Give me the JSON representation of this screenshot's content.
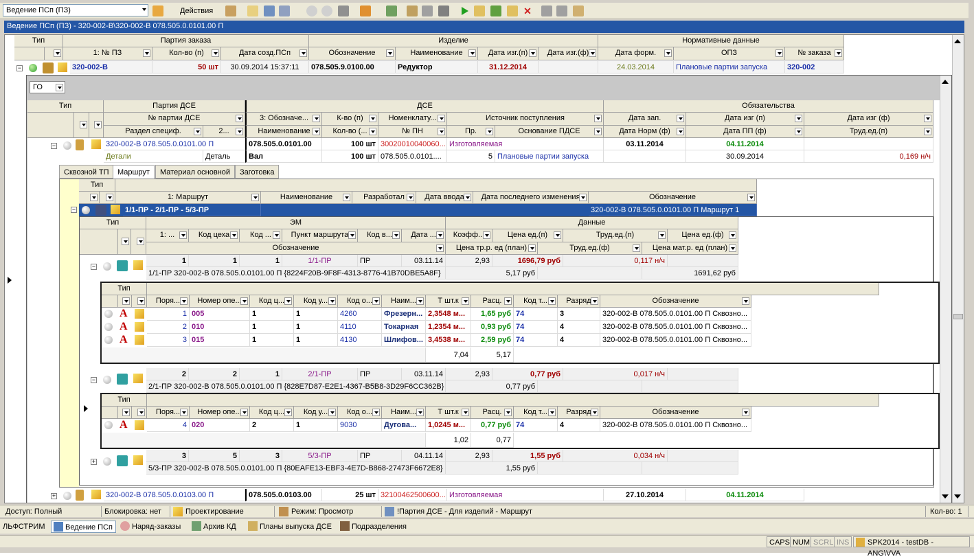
{
  "toolbar": {
    "combo_value": "Ведение ПСп (ПЗ)",
    "actions_label": "Действия"
  },
  "title": "Ведение ПСп (ПЗ) - 320-002-В\\320-002-В 078.505.0.0101.00 П",
  "top_grid": {
    "group_headers": [
      "Тип",
      "Партия заказа",
      "Изделие",
      "Нормативные данные"
    ],
    "columns": [
      "1: № ПЗ",
      "Кол-во (п)",
      "Дата созд.ПСп",
      "Обозначение",
      "Наименование",
      "Дата изг.(п)",
      "Дата изг.(ф)",
      "Дата форм.",
      "ОПЗ",
      "№ заказа"
    ],
    "row": {
      "pz": "320-002-В",
      "qty": "50 шт",
      "created": "30.09.2014 15:37:11",
      "designation": "078.505.9.0100.00",
      "name": "Редуктор",
      "date_plan": "31.12.2014",
      "date_fact": "",
      "date_form": "24.03.2014",
      "opz": "Плановые партии запуска",
      "order_no": "320-002"
    }
  },
  "go_filter": "ГО",
  "dse_grid": {
    "group_headers": [
      "Тип",
      "Партия ДСЕ",
      "ДСЕ",
      "Обязательства"
    ],
    "row1_headers": [
      "№ партии ДСЕ",
      "3: Обозначе...",
      "К-во (п)",
      "Номенклату...",
      "Источник поступления",
      "Дата зап.",
      "Дата изг (п)",
      "Дата изг (ф)"
    ],
    "row2_headers": [
      "Раздел специф.",
      "2...",
      "Наименование",
      "Кол-во (...",
      "№ ПН",
      "Пр.",
      "Основание ПДСЕ",
      "Дата Норм (ф)",
      "Дата ПП (ф)",
      "Труд.ед.(п)"
    ],
    "item1": {
      "batch": "320-002-В 078.505.0.0101.00 П",
      "designation": "078.505.0.0101.00",
      "qty": "100 шт",
      "nomen": "30020010040060...",
      "source": "Изготовляемая",
      "date_start": "03.11.2014",
      "date_make": "04.11.2014",
      "section": "Детали",
      "type": "Деталь",
      "name": "Вал",
      "qty2": "100 шт",
      "pn": "078.505.0.0101....",
      "pr": "5",
      "basis": "Плановые партии запуска",
      "date_pp": "30.09.2014",
      "labor": "0,169 н/ч"
    },
    "item2": {
      "batch": "320-002-В 078.505.0.0103.00 П",
      "designation": "078.505.0.0103.00",
      "qty": "25 шт",
      "nomen": "32100462500600...",
      "source": "Изготовляемая",
      "date_start": "27.10.2014",
      "date_make": "04.11.2014"
    }
  },
  "tabs": [
    "Сквозной ТП",
    "Маршрут",
    "Материал основной",
    "Заготовка"
  ],
  "route_grid": {
    "headers": [
      "Тип",
      "1: Маршрут",
      "Наименование",
      "Разработал",
      "Дата ввода",
      "Дата последнего изменения",
      "Обозначение"
    ],
    "row": {
      "route": "1/1-ПР - 2/1-ПР - 5/3-ПР",
      "designation": "320-002-В 078.505.0.0101.00 П Маршрут 1"
    }
  },
  "em_grid": {
    "group_headers": [
      "Тип",
      "ЭМ",
      "Данные"
    ],
    "row1_headers": [
      "1: ...",
      "Код цеха",
      "Код ...",
      "Пункт маршрута",
      "Код в...",
      "Дата ...",
      "Коэфф...",
      "Цена ед.(п)",
      "Труд.ед.(п)",
      "Цена ед.(ф)"
    ],
    "row2_headers": [
      "Обозначение",
      "Цена тр.р. ед (план)",
      "Труд.ед.(ф)",
      "Цена мат.р. ед (план)"
    ],
    "rows": [
      {
        "n1": "1",
        "n2": "1",
        "n3": "1",
        "point": "1/1-ПР",
        "code": "ПР",
        "date": "03.11.14",
        "coef": "2,93",
        "price": "1696,79 руб",
        "labor": "0,117 н/ч",
        "desc": "1/1-ПР 320-002-В 078.505.0.0101.00 П {8224F20B-9F8F-4313-8776-41B70DBE5A8F}",
        "price_tr": "5,17 руб",
        "price_mat": "1691,62 руб"
      },
      {
        "n1": "2",
        "n2": "2",
        "n3": "1",
        "point": "2/1-ПР",
        "code": "ПР",
        "date": "03.11.14",
        "coef": "2,93",
        "price": "0,77 руб",
        "labor": "0,017 н/ч",
        "desc": "2/1-ПР 320-002-В 078.505.0.0101.00 П {828E7D87-E2E1-4367-B5B8-3D29F6CC362B}",
        "price_tr": "0,77 руб",
        "price_mat": ""
      },
      {
        "n1": "3",
        "n2": "5",
        "n3": "3",
        "point": "5/3-ПР",
        "code": "ПР",
        "date": "04.11.14",
        "coef": "2,93",
        "price": "1,55 руб",
        "labor": "0,034 н/ч",
        "desc": "5/3-ПР 320-002-В 078.505.0.0101.00 П {80EAFE13-EBF3-4E7D-B868-27473F6672E8}",
        "price_tr": "1,55 руб",
        "price_mat": ""
      }
    ]
  },
  "ops_headers": [
    "Тип",
    "Поря...",
    "Номер опе...",
    "Код ц...",
    "Код у...",
    "Код о...",
    "Наим...",
    "Т шт.к",
    "Расц.",
    "Код т...",
    "Разряд",
    "Обозначение"
  ],
  "ops1": [
    {
      "order": "1",
      "num": "005",
      "c1": "1",
      "c2": "1",
      "code": "4260",
      "name": "Фрезерн...",
      "t": "2,3548 м...",
      "rate": "1,65 руб",
      "tc": "74",
      "grade": "3",
      "desig": "320-002-В 078.505.0.0101.00 П Сквозно..."
    },
    {
      "order": "2",
      "num": "010",
      "c1": "1",
      "c2": "1",
      "code": "4110",
      "name": "Токарная",
      "t": "1,2354 м...",
      "rate": "0,93 руб",
      "tc": "74",
      "grade": "4",
      "desig": "320-002-В 078.505.0.0101.00 П Сквозно..."
    },
    {
      "order": "3",
      "num": "015",
      "c1": "1",
      "c2": "1",
      "code": "4130",
      "name": "Шлифов...",
      "t": "3,4538 м...",
      "rate": "2,59 руб",
      "tc": "74",
      "grade": "4",
      "desig": "320-002-В 078.505.0.0101.00 П Сквозно..."
    }
  ],
  "ops1_totals": {
    "t": "7,04",
    "rate": "5,17"
  },
  "ops2": [
    {
      "order": "4",
      "num": "020",
      "c1": "2",
      "c2": "1",
      "code": "9030",
      "name": "Дугова...",
      "t": "1,0245 м...",
      "rate": "0,77 руб",
      "tc": "74",
      "grade": "4",
      "desig": "320-002-В 078.505.0.0101.00 П Сквозно..."
    }
  ],
  "ops2_totals": {
    "t": "1,02",
    "rate": "0,77"
  },
  "status": {
    "access": "Доступ: Полный",
    "lock": "Блокировка: нет",
    "mode1": "Проектирование",
    "mode2": "Режим: Просмотр",
    "context": "!Партия ДСЕ - Для изделий - Маршрут",
    "count": "Кол-во: 1"
  },
  "taskbar": [
    "ЛЬФСТРИМ",
    "Ведение ПСп",
    "Наряд-заказы",
    "Архив КД",
    "Планы выпуска ДСЕ",
    "Подразделения"
  ],
  "indicators": [
    "CAPS",
    "NUM",
    "SCRL",
    "INS",
    "SPK2014 - testDB - ANG\\VVA"
  ],
  "colors": {
    "title_bg": "#2456a5",
    "header_bg": "#ece9d8",
    "selected_row": "#2456a5"
  }
}
